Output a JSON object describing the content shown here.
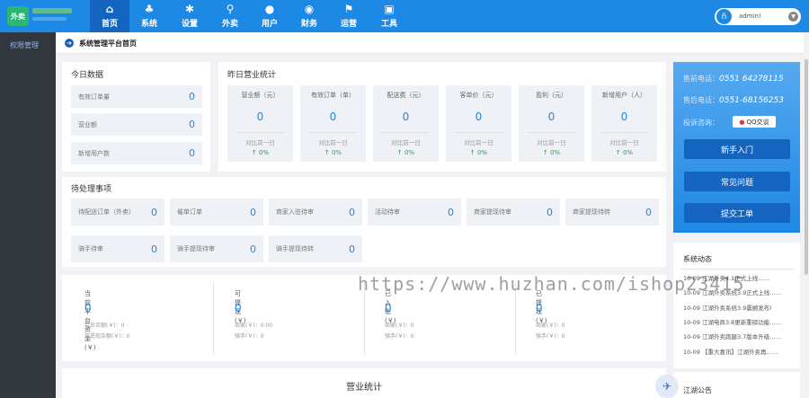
{
  "app": {
    "logo_text": "外卖"
  },
  "nav": [
    {
      "label": "首页",
      "icon": "home-icon",
      "glyph": "⌂"
    },
    {
      "label": "系统",
      "icon": "sitemap-icon",
      "glyph": "♣"
    },
    {
      "label": "设置",
      "icon": "gear-icon",
      "glyph": "✱"
    },
    {
      "label": "外卖",
      "icon": "scooter-icon",
      "glyph": "⚲"
    },
    {
      "label": "用户",
      "icon": "user-icon",
      "glyph": "●"
    },
    {
      "label": "财务",
      "icon": "money-icon",
      "glyph": "◉"
    },
    {
      "label": "运营",
      "icon": "people-icon",
      "glyph": "⚑"
    },
    {
      "label": "工具",
      "icon": "toolbox-icon",
      "glyph": "▣"
    }
  ],
  "user": {
    "name": "admin!"
  },
  "sidebar": {
    "item": "权限管理"
  },
  "breadcrumb": "系统管理平台首页",
  "today": {
    "title": "今日数据",
    "rows": [
      {
        "label": "有效订单量",
        "value": "0"
      },
      {
        "label": "营业额",
        "value": "0"
      },
      {
        "label": "新增用户数",
        "value": "0"
      }
    ]
  },
  "yesterday": {
    "title": "昨日营业统计",
    "cards": [
      {
        "label": "营业额（元）",
        "value": "0",
        "compare": "对比前一日",
        "pct": "↑ 0%"
      },
      {
        "label": "有效订单（单）",
        "value": "0",
        "compare": "对比前一日",
        "pct": "↑ 0%"
      },
      {
        "label": "配送费（元）",
        "value": "0",
        "compare": "对比前一日",
        "pct": "↑ 0%"
      },
      {
        "label": "客单价（元）",
        "value": "0",
        "compare": "对比前一日",
        "pct": "↑ 0%"
      },
      {
        "label": "盈利（元）",
        "value": "0",
        "compare": "对比前一日",
        "pct": "↑ 0%"
      },
      {
        "label": "新增用户（人）",
        "value": "0",
        "compare": "对比前一日",
        "pct": "↑ 0%"
      }
    ]
  },
  "pending": {
    "title": "待处理事项",
    "row1": [
      {
        "label": "待配送订单（外卖）",
        "value": "0"
      },
      {
        "label": "催单订单",
        "value": "0"
      },
      {
        "label": "商家入驻待审",
        "value": "0"
      },
      {
        "label": "活动待审",
        "value": "0"
      },
      {
        "label": "商家提现待审",
        "value": "0"
      },
      {
        "label": "商家提现待转",
        "value": "0"
      }
    ],
    "row2": [
      {
        "label": "骑手待审",
        "value": "0"
      },
      {
        "label": "骑手提现待审",
        "value": "0"
      },
      {
        "label": "骑手提现待转",
        "value": "0"
      }
    ]
  },
  "funds": [
    {
      "label": "当前平台资金(￥)",
      "value": "0",
      "s1": "会员余额(￥)：0",
      "s2": "可提现余额(￥)：0"
    },
    {
      "label": "可提现(￥)",
      "value": "0",
      "s1": "商家(￥)：0.00",
      "s2": "骑手(￥)：0"
    },
    {
      "label": "已入账(￥)",
      "value": "0",
      "s1": "商家(￥)：0",
      "s2": "骑手(￥)：0"
    },
    {
      "label": "已提现(￥)",
      "value": "0",
      "s1": "商家(￥)：0",
      "s2": "骑手(￥)：0"
    }
  ],
  "contact": {
    "presale_label": "售前电话：",
    "presale_phone": "0551 64278115",
    "aftersale_label": "售后电话：",
    "aftersale_phone": "0551-68156253",
    "consult_label": "投诉咨询：",
    "qq_label": "QQ交谈"
  },
  "buttons": {
    "guide": "新手入门",
    "faq": "常见问题",
    "ticket": "提交工单"
  },
  "news": {
    "title": "系统动态",
    "items": [
      "10-09  江湖外卖4.1正式上线……",
      "10-09  江湖外卖系统3.9正式上线……",
      "10-09  江湖外卖系统3.9震撼发布!",
      "10-09  江湖电商3.8更新重磅功能……",
      "10-09  江湖外卖跑腿3.7版本升级……",
      "10-09  【重大喜讯】江湖外卖再……"
    ]
  },
  "notice": {
    "title": "江湖公告"
  },
  "stats": {
    "title": "营业统计"
  },
  "watermark": "https://www.huzhan.com/ishop23415"
}
